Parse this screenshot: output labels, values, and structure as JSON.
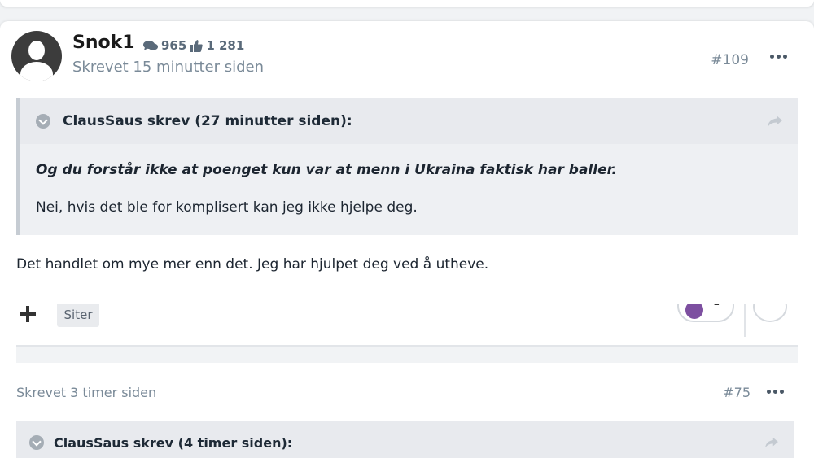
{
  "post": {
    "username": "Snok1",
    "posts_count": "965",
    "likes_count": "1 281",
    "timestamp": "Skrevet 15 minutter siden",
    "post_number": "#109",
    "quote": {
      "header": "ClausSaus skrev (27 minutter siden):",
      "bold_line": "Og du forstår ikke at poenget kun var at menn i Ukraina faktisk har baller.",
      "reply_line": "Nei, hvis det ble for komplisert kan jeg ikke hjelpe deg."
    },
    "body": "Det handlet om mye mer enn det. Jeg har hjulpet deg ved å utheve."
  },
  "actions": {
    "quote_button": "Siter",
    "reaction_count": "1"
  },
  "next_post": {
    "timestamp": "Skrevet 3 timer siden",
    "post_number": "#75",
    "quote_header": "ClausSaus skrev (4 timer siden):"
  },
  "icons": {
    "comments": "comments-icon",
    "likes": "thumbs-up-icon",
    "more": "more-options-icon",
    "share": "share-icon",
    "collapse": "chevron-down-icon"
  },
  "colors": {
    "quote_bg": "#eef0f3",
    "muted_text": "#7a8a98",
    "reaction_purple": "#7d4fa0"
  }
}
